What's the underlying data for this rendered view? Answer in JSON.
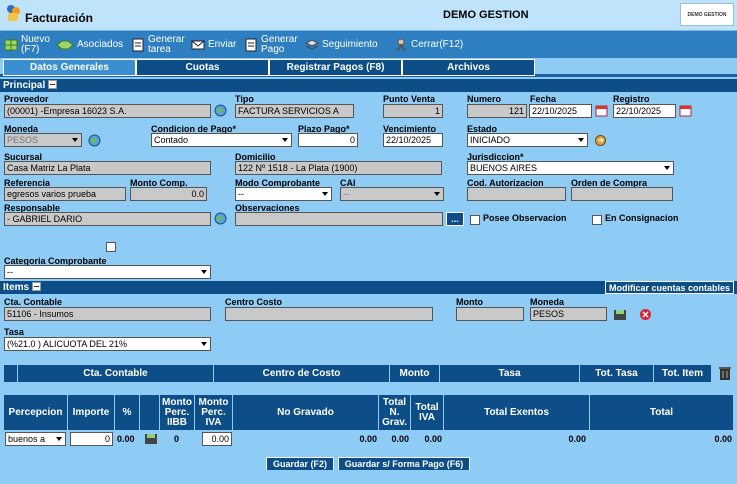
{
  "app": {
    "title": "Facturación",
    "company": "DEMO GESTION",
    "logo_text": "DEMO GESTION"
  },
  "toolbar": {
    "nuevo": "Nuevo\n(F7)",
    "asociados": "Asociados",
    "generar_tarea": "Generar\ntarea",
    "enviar": "Enviar",
    "generar_pago": "Generar\nPago",
    "seguimiento": "Seguimiento",
    "cerrar": "Cerrar(F12)"
  },
  "tabs": [
    "Datos Generales",
    "Cuotas",
    "Registrar Pagos (F8)",
    "Archivos"
  ],
  "principal": {
    "section_title": "Principal",
    "proveedor_label": "Proveedor",
    "proveedor_value": "(00001) -Empresa 16023 S.A.",
    "tipo_label": "Tipo",
    "tipo_value": "FACTURA SERVICIOS A",
    "punto_venta_label": "Punto Venta",
    "punto_venta_value": "1",
    "numero_label": "Numero",
    "numero_value": "121",
    "fecha_label": "Fecha",
    "fecha_value": "22/10/2025",
    "registro_label": "Registro",
    "registro_value": "22/10/2025",
    "moneda_label": "Moneda",
    "moneda_value": "PESOS",
    "condicion_label": "Condicion de Pago*",
    "condicion_value": "Contado",
    "plazo_label": "Plazo Pago*",
    "plazo_value": "0",
    "vencimiento_label": "Vencimiento",
    "vencimiento_value": "22/10/2025",
    "estado_label": "Estado",
    "estado_value": "INICIADO",
    "sucursal_label": "Sucursal",
    "sucursal_value": "Casa Matriz La Plata",
    "domicilio_label": "Domicilio",
    "domicilio_value": "122 Nº 1518 - La Plata (1900)",
    "jurisdiccion_label": "Jurisdiccion*",
    "jurisdiccion_value": "BUENOS AIRES",
    "referencia_label": "Referencia",
    "referencia_value": "egresos varios prueba",
    "monto_comp_label": "Monto Comp.",
    "monto_comp_value": "0.0",
    "modo_label": "Modo Comprobante",
    "modo_value": "--",
    "cai_label": "CAI",
    "cai_value": "--",
    "cod_aut_label": "Cod. Autorizacion",
    "cod_aut_value": "",
    "orden_label": "Orden de Compra",
    "orden_value": "",
    "responsable_label": "Responsable",
    "responsable_value": "- GABRIEL DARIO",
    "observaciones_label": "Observaciones",
    "observaciones_value": "",
    "obs_button": "...",
    "posee_obs_label": "Posee Observacion",
    "consignacion_label": "En Consignacion",
    "categoria_label": "Categoria Comprobante",
    "categoria_value": "--"
  },
  "items": {
    "section_title": "Items",
    "modificar_button": "Modificar cuentas contables",
    "cta_label": "Cta. Contable",
    "cta_value": "51106 - Insumos",
    "centro_label": "Centro Costo",
    "centro_value": "",
    "monto_label": "Monto",
    "monto_value": "",
    "moneda_label": "Moneda",
    "moneda_value": "PESOS",
    "tasa_label": "Tasa",
    "tasa_value": "(%21.0 ) ALICUOTA DEL 21%",
    "headers": [
      "Cta. Contable",
      "Centro de Costo",
      "Monto",
      "Tasa",
      "Tot. Tasa",
      "Tot. Item"
    ]
  },
  "totals": {
    "headers": [
      "Percepcion",
      "Importe",
      "%",
      "Monto Perc. IIBB",
      "Monto Perc. IVA",
      "No Gravado",
      "Total N. Grav.",
      "Total IVA",
      "Total Exentos",
      "Total"
    ],
    "percepcion_value": "buenos a",
    "importe_value": "0",
    "pct_value": "0.00",
    "perc_iibb_value": "0",
    "perc_iva_value": "0.00",
    "no_gravado_value": "0.00",
    "total_ngrav_value": "0.00",
    "total_iva_value": "0.00",
    "total_exentos_value": "0.00",
    "total_value": "0.00"
  },
  "actions": {
    "guardar": "Guardar (F2)",
    "guardar_forma_pago": "Guardar s/ Forma Pago (F6)"
  }
}
